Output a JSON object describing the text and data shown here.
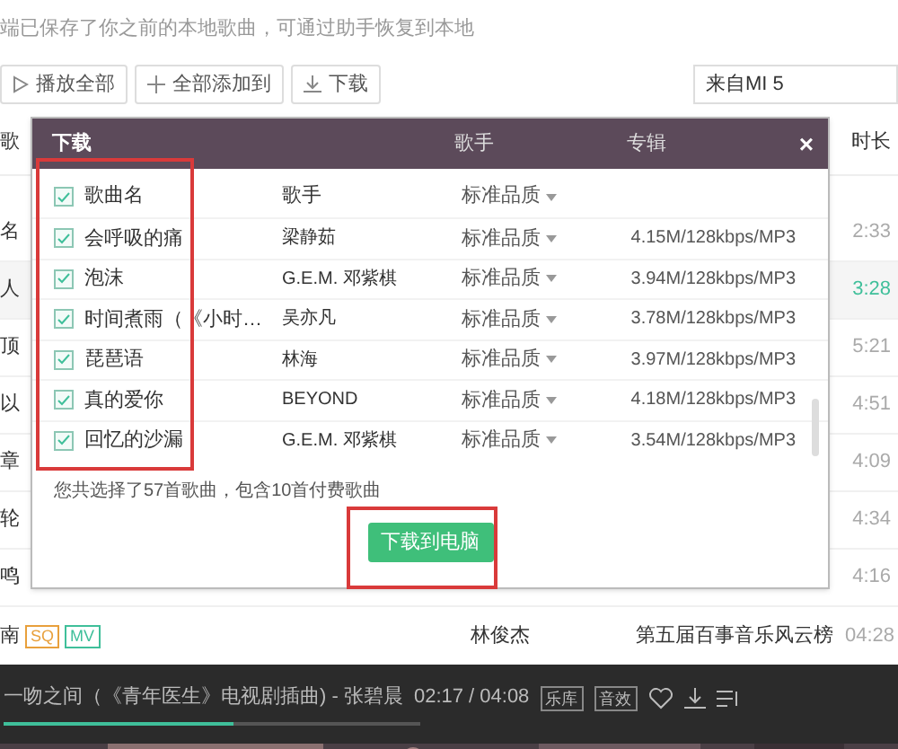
{
  "notice": "端已保存了你之前的本地歌曲，可通过助手恢复到本地",
  "toolbar": {
    "buttons": [
      {
        "kind": "play",
        "label": "播放全部"
      },
      {
        "kind": "add",
        "label": "全部添加到"
      },
      {
        "kind": "download",
        "label": "下载"
      }
    ],
    "source": "来自MI 5"
  },
  "table": {
    "columns": [
      "歌",
      "时长"
    ],
    "rows": [
      {
        "song": "名",
        "duration": "2:33",
        "selected": false
      },
      {
        "song": "人",
        "duration": "3:28",
        "selected": true
      },
      {
        "song": "顶",
        "duration": "5:21",
        "selected": false
      },
      {
        "song": "以",
        "duration": "4:51",
        "selected": false
      },
      {
        "song": "章",
        "duration": "4:09",
        "selected": false
      },
      {
        "song": "轮",
        "duration": "4:34",
        "selected": false
      },
      {
        "song": "鸣",
        "duration": "4:16",
        "selected": false
      }
    ],
    "last_row": {
      "song": "南",
      "tags": [
        {
          "label": "SQ",
          "color": "#e8a03c"
        },
        {
          "label": "MV",
          "color": "#3fbf9a"
        }
      ],
      "singer": "林俊杰",
      "album": "第五届百事音乐风云榜",
      "duration": "04:28"
    }
  },
  "dialog": {
    "title": "下载",
    "close": "×",
    "header_columns": [
      "歌手",
      "专辑"
    ],
    "list_header": {
      "checked": true,
      "name": "歌曲名",
      "singer": "歌手",
      "quality": "标准品质"
    },
    "songs": [
      {
        "checked": true,
        "name": "会呼吸的痛",
        "singer": "梁静茹",
        "quality": "标准品质",
        "size": "4.15M/128kbps/MP3"
      },
      {
        "checked": true,
        "name": "泡沫",
        "singer": "G.E.M. 邓紫棋",
        "quality": "标准品质",
        "size": "3.94M/128kbps/MP3"
      },
      {
        "checked": true,
        "name": "时间煮雨（《小时…",
        "singer": "吴亦凡",
        "quality": "标准品质",
        "size": "3.78M/128kbps/MP3"
      },
      {
        "checked": true,
        "name": "琵琶语",
        "singer": "林海",
        "quality": "标准品质",
        "size": "3.97M/128kbps/MP3"
      },
      {
        "checked": true,
        "name": "真的爱你",
        "singer": "BEYOND",
        "quality": "标准品质",
        "size": "4.18M/128kbps/MP3"
      },
      {
        "checked": true,
        "name": "回忆的沙漏",
        "singer": "G.E.M. 邓紫棋",
        "quality": "标准品质",
        "size": "3.54M/128kbps/MP3"
      }
    ],
    "summary": "您共选择了57首歌曲，包含10首付费歌曲",
    "button": "下载到电脑"
  },
  "player": {
    "song": "一吻之间（《青年医生》电视剧插曲) - 张碧晨",
    "time": "02:17 / 04:08",
    "level": 0.55,
    "buttons": [
      "乐库",
      "音效"
    ]
  }
}
